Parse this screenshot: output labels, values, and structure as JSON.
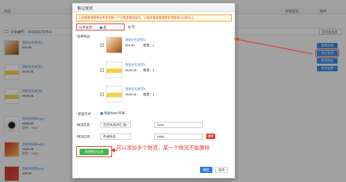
{
  "background": {
    "columns": {
      "product": "商品",
      "buyer_message": "买家留言",
      "action": "操作"
    },
    "order": {
      "label": "订单编号：2019011707511",
      "print_label": "打印发货单"
    },
    "products": [
      {
        "name": "测试分包发货1",
        "price": "¥16.50",
        "qty": "数量：1"
      },
      {
        "name": "测试分包发货1",
        "price": "¥100.00",
        "qty": "数量：1"
      },
      {
        "name": "测试分包发货2",
        "price": "¥100.00",
        "qty": "数量：1"
      },
      {
        "name": "测试共同商wyyy",
        "price": "¥100.00",
        "qty": "数量：1",
        "spec": "颜色：wyyy"
      },
      {
        "name": "测试共同商wyyy",
        "price": "¥100.00",
        "qty": "数量：1",
        "spec": "颜色：wyyy"
      },
      {
        "name": "测试共同商yyyy",
        "price": "¥30.00",
        "qty": "数量：1"
      }
    ],
    "side_buttons": [
      "查看详情",
      "标记发货",
      "修改地址",
      "修改运费"
    ]
  },
  "modal": {
    "title": "标记发货",
    "close_symbol": "×",
    "notice": "1.如果需要使用分单发货和一个订单多物流发货，小程序版本需要更新到版本v3.0及以上",
    "split_label": "*分单发货：",
    "split_yes": "是",
    "split_no": "否",
    "select_label": "*选择商品：",
    "items": [
      {
        "name": "测试分包发货1",
        "price": "¥16.50",
        "qty": "数量：1",
        "checked": true
      },
      {
        "name": "测试分包发货1",
        "price": "¥100.00",
        "qty": "数量：1",
        "checked": false
      },
      {
        "name": "测试分包发货2",
        "price": "¥100.00",
        "qty": "数量：1",
        "checked": false
      }
    ],
    "delivery_label": "* 配送方式：",
    "delivery_value": "快递/EMS/平邮",
    "logistics_label": "*物流信息：",
    "logistics": [
      {
        "company": "百世快递(原汇通)",
        "number": "3333"
      },
      {
        "company": "申通快递",
        "number": "6666",
        "delete_label": "删除"
      }
    ],
    "add_button": "新增物流信息",
    "ok_button": "确定",
    "cancel_button": "取消"
  },
  "annotation": "可以添加多个物流，某一个物流不能删除",
  "colors": {
    "accent": "#2c7fd1",
    "annotation": "#e53935",
    "add_button": "#3bb34a"
  }
}
